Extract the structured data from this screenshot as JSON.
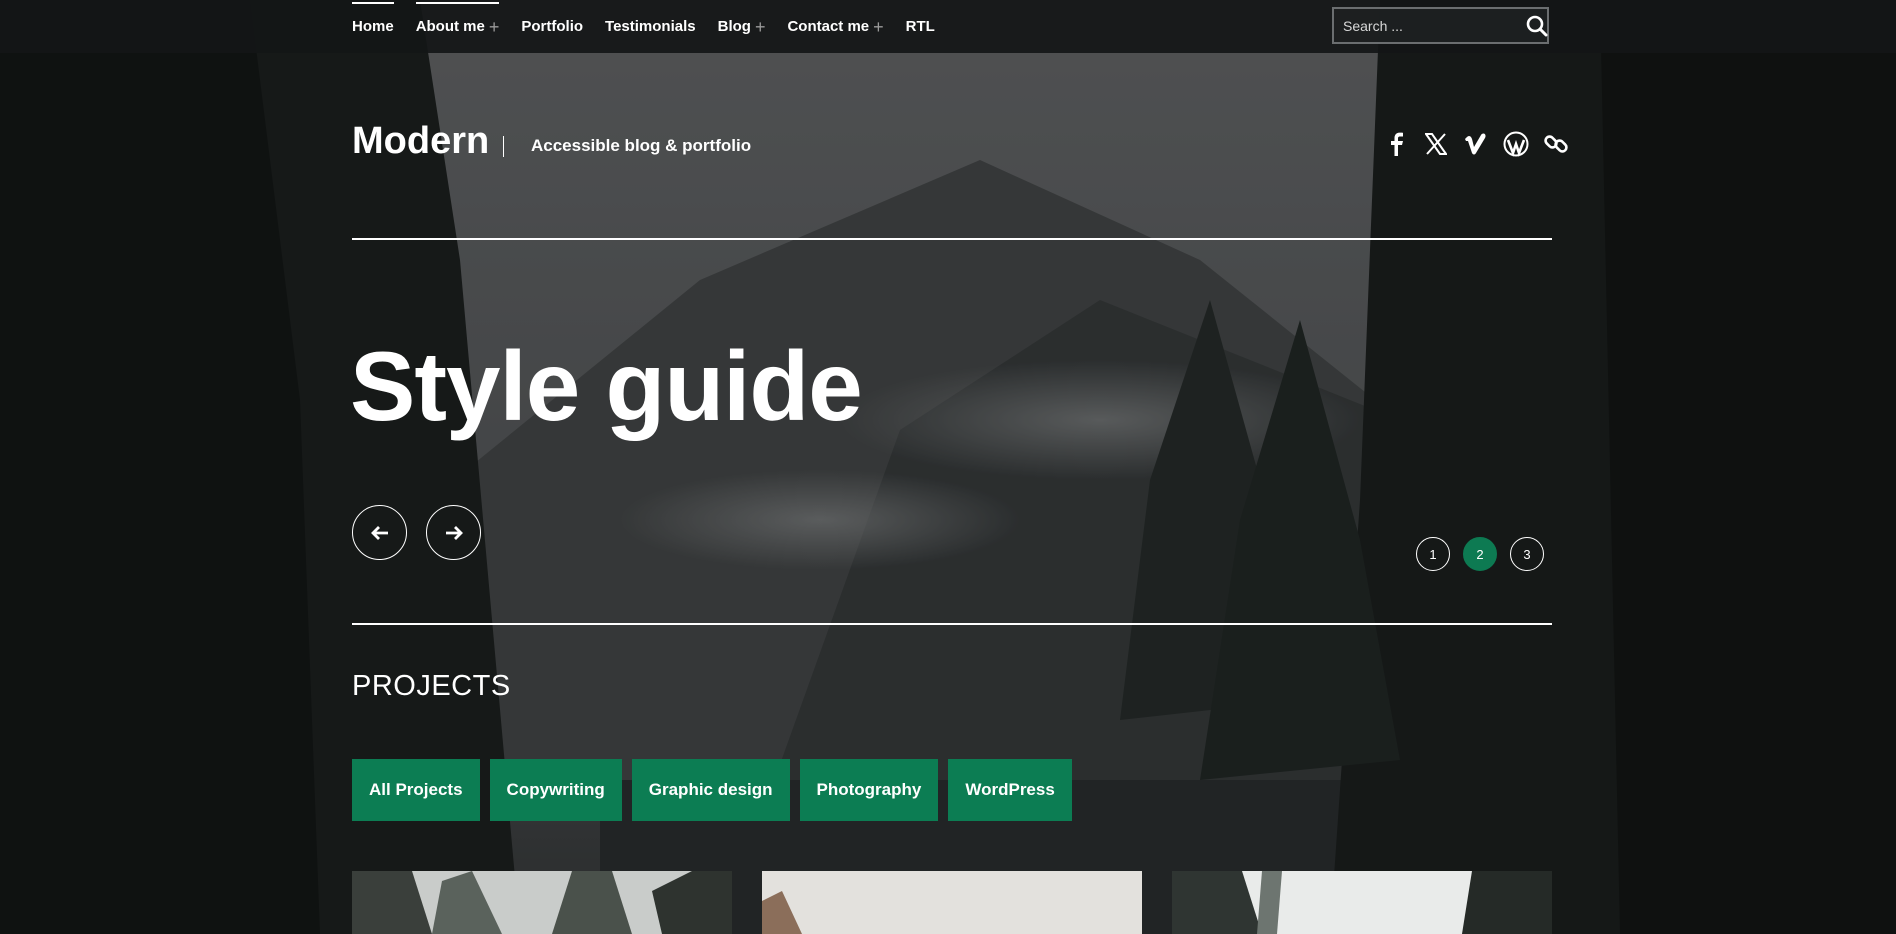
{
  "nav": {
    "items": [
      {
        "label": "Home",
        "active": true,
        "has_submenu": false
      },
      {
        "label": "About me",
        "active": true,
        "has_submenu": true
      },
      {
        "label": "Portfolio",
        "active": false,
        "has_submenu": false
      },
      {
        "label": "Testimonials",
        "active": false,
        "has_submenu": false
      },
      {
        "label": "Blog",
        "active": false,
        "has_submenu": true
      },
      {
        "label": "Contact me",
        "active": false,
        "has_submenu": true
      },
      {
        "label": "RTL",
        "active": false,
        "has_submenu": false
      }
    ],
    "submenu_glyph": "+"
  },
  "search": {
    "placeholder": "Search ...",
    "icon": "search-icon"
  },
  "header": {
    "site_title": "Modern",
    "tagline": "Accessible blog & portfolio",
    "social_icons": [
      "facebook-icon",
      "x-icon",
      "vimeo-icon",
      "wordpress-icon",
      "link-icon"
    ]
  },
  "hero": {
    "title": "Style guide",
    "prev_icon": "arrow-left-icon",
    "next_icon": "arrow-right-icon",
    "pages": [
      "1",
      "2",
      "3"
    ],
    "active_page": "2"
  },
  "projects": {
    "heading": "PROJECTS",
    "filters": [
      "All Projects",
      "Copywriting",
      "Graphic design",
      "Photography",
      "WordPress"
    ]
  },
  "colors": {
    "accent": "#0c7d53",
    "topbar": "#141617"
  }
}
